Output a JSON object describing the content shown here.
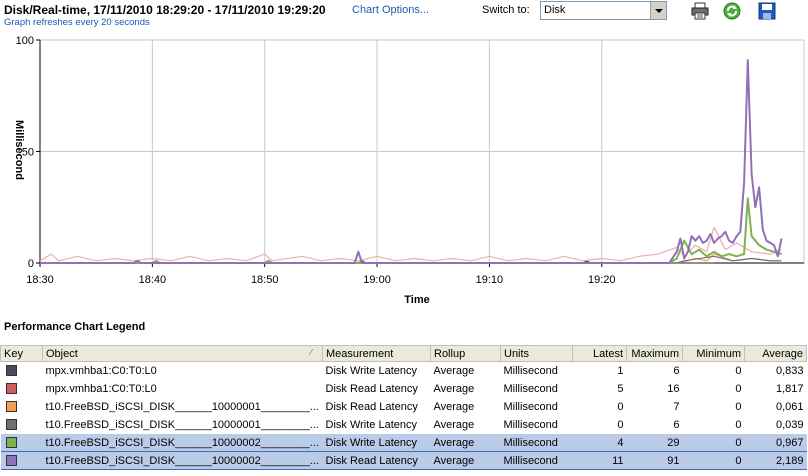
{
  "header": {
    "title": "Disk/Real-time, 17/11/2010 18:29:20 - 17/11/2010 19:29:20",
    "chart_options": "Chart Options...",
    "subtitle": "Graph refreshes every 20 seconds",
    "switch_label": "Switch to:",
    "switch_value": "Disk",
    "icons": [
      "printer-icon",
      "refresh-icon",
      "save-icon"
    ]
  },
  "chart_data": {
    "type": "line",
    "ylabel": "Millisecond",
    "xlabel": "Time",
    "ylim": [
      0,
      100
    ],
    "yticks": [
      0,
      50,
      100
    ],
    "xticks": [
      "18:30",
      "18:40",
      "18:50",
      "19:00",
      "19:10",
      "19:20"
    ],
    "grid": true,
    "series": [
      {
        "name": "mpx.vmhba1:C0:T0:L0 Disk Write Latency",
        "color": "#4a4a5a",
        "points": [
          [
            0,
            0
          ],
          [
            85,
            0
          ],
          [
            86,
            1
          ],
          [
            87,
            0
          ],
          [
            100,
            0
          ],
          [
            145,
            0
          ],
          [
            146,
            1
          ],
          [
            147,
            0
          ],
          [
            180,
            0
          ]
        ]
      },
      {
        "name": "mpx.vmhba1:C0:T0:L0 Disk Read Latency",
        "color": "#e8b0b0",
        "points": [
          [
            0,
            1
          ],
          [
            3,
            4
          ],
          [
            5,
            1
          ],
          [
            10,
            3
          ],
          [
            15,
            1
          ],
          [
            20,
            2
          ],
          [
            25,
            1
          ],
          [
            30,
            2
          ],
          [
            35,
            1
          ],
          [
            40,
            3
          ],
          [
            45,
            1
          ],
          [
            50,
            2
          ],
          [
            55,
            1
          ],
          [
            60,
            4
          ],
          [
            62,
            1
          ],
          [
            70,
            3
          ],
          [
            75,
            1
          ],
          [
            80,
            2
          ],
          [
            85,
            1
          ],
          [
            90,
            3
          ],
          [
            95,
            1
          ],
          [
            100,
            2
          ],
          [
            105,
            1
          ],
          [
            110,
            2
          ],
          [
            115,
            1
          ],
          [
            120,
            3
          ],
          [
            125,
            1
          ],
          [
            130,
            2
          ],
          [
            135,
            1
          ],
          [
            140,
            3
          ],
          [
            145,
            1
          ],
          [
            150,
            2
          ],
          [
            155,
            1
          ],
          [
            160,
            3
          ],
          [
            165,
            4
          ],
          [
            170,
            7
          ],
          [
            172,
            3
          ],
          [
            175,
            8
          ],
          [
            178,
            5
          ],
          [
            180,
            16
          ],
          [
            183,
            6
          ],
          [
            186,
            9
          ],
          [
            190,
            5
          ],
          [
            195,
            4
          ],
          [
            198,
            6
          ]
        ]
      },
      {
        "name": "t10.FreeBSD_iSCSI_DISK______10000001________... Disk Write Latency",
        "color": "#f0a050",
        "points": [
          [
            0,
            0
          ],
          [
            170,
            0
          ],
          [
            173,
            1
          ],
          [
            175,
            2
          ],
          [
            178,
            1
          ],
          [
            180,
            4
          ],
          [
            185,
            1
          ],
          [
            190,
            2
          ],
          [
            195,
            1
          ],
          [
            198,
            1
          ]
        ]
      },
      {
        "name": "t10.FreeBSD_iSCSI_DISK______10000001________... Disk Read Latency",
        "color": "#707070",
        "points": [
          [
            0,
            0
          ],
          [
            170,
            0
          ],
          [
            172,
            1
          ],
          [
            180,
            3
          ],
          [
            185,
            1
          ],
          [
            190,
            2
          ],
          [
            195,
            1
          ],
          [
            198,
            1
          ]
        ]
      },
      {
        "name": "t10.FreeBSD_iSCSI_DISK______10000002________... Disk Write Latency",
        "color": "#80b050",
        "points": [
          [
            0,
            0
          ],
          [
            30,
            0
          ],
          [
            31,
            1
          ],
          [
            32,
            0
          ],
          [
            60,
            0
          ],
          [
            61,
            1
          ],
          [
            62,
            0
          ],
          [
            168,
            0
          ],
          [
            170,
            2
          ],
          [
            172,
            10
          ],
          [
            174,
            4
          ],
          [
            176,
            6
          ],
          [
            178,
            3
          ],
          [
            180,
            5
          ],
          [
            182,
            3
          ],
          [
            184,
            4
          ],
          [
            186,
            3
          ],
          [
            188,
            4
          ],
          [
            189,
            29
          ],
          [
            190,
            12
          ],
          [
            192,
            8
          ],
          [
            194,
            6
          ],
          [
            196,
            5
          ],
          [
            198,
            4
          ]
        ]
      },
      {
        "name": "t10.FreeBSD_iSCSI_DISK______10000002________... Disk Read Latency",
        "color": "#9070b8",
        "points": [
          [
            0,
            0
          ],
          [
            25,
            0
          ],
          [
            26,
            1
          ],
          [
            27,
            0
          ],
          [
            84,
            0
          ],
          [
            85,
            5
          ],
          [
            86,
            0
          ],
          [
            168,
            0
          ],
          [
            170,
            5
          ],
          [
            171,
            11
          ],
          [
            172,
            2
          ],
          [
            173,
            5
          ],
          [
            174,
            12
          ],
          [
            175,
            10
          ],
          [
            176,
            12
          ],
          [
            177,
            9
          ],
          [
            178,
            10
          ],
          [
            179,
            13
          ],
          [
            180,
            9
          ],
          [
            181,
            11
          ],
          [
            182,
            12
          ],
          [
            183,
            14
          ],
          [
            184,
            10
          ],
          [
            185,
            9
          ],
          [
            186,
            12
          ],
          [
            187,
            14
          ],
          [
            188,
            36
          ],
          [
            189,
            91
          ],
          [
            190,
            40
          ],
          [
            191,
            25
          ],
          [
            192,
            34
          ],
          [
            193,
            15
          ],
          [
            194,
            10
          ],
          [
            195,
            9
          ],
          [
            196,
            8
          ],
          [
            197,
            3
          ],
          [
            198,
            11
          ]
        ]
      }
    ]
  },
  "legend": {
    "title": "Performance Chart Legend",
    "columns": [
      "Key",
      "Object",
      "Measurement",
      "Rollup",
      "Units",
      "Latest",
      "Maximum",
      "Minimum",
      "Average"
    ],
    "rows": [
      {
        "color": "#4a4a5a",
        "object": "mpx.vmhba1:C0:T0:L0",
        "measurement": "Disk Write Latency",
        "rollup": "Average",
        "units": "Millisecond",
        "latest": "1",
        "maximum": "6",
        "minimum": "0",
        "average": "0,833",
        "selected": false
      },
      {
        "color": "#d06060",
        "object": "mpx.vmhba1:C0:T0:L0",
        "measurement": "Disk Read Latency",
        "rollup": "Average",
        "units": "Millisecond",
        "latest": "5",
        "maximum": "16",
        "minimum": "0",
        "average": "1,817",
        "selected": false
      },
      {
        "color": "#f0a050",
        "object": "t10.FreeBSD_iSCSI_DISK______10000001________...",
        "measurement": "Disk Read Latency",
        "rollup": "Average",
        "units": "Millisecond",
        "latest": "0",
        "maximum": "7",
        "minimum": "0",
        "average": "0,061",
        "selected": false
      },
      {
        "color": "#707070",
        "object": "t10.FreeBSD_iSCSI_DISK______10000001________...",
        "measurement": "Disk Write Latency",
        "rollup": "Average",
        "units": "Millisecond",
        "latest": "0",
        "maximum": "6",
        "minimum": "0",
        "average": "0,039",
        "selected": false
      },
      {
        "color": "#80b050",
        "object": "t10.FreeBSD_iSCSI_DISK______10000002________...",
        "measurement": "Disk Write Latency",
        "rollup": "Average",
        "units": "Millisecond",
        "latest": "4",
        "maximum": "29",
        "minimum": "0",
        "average": "0,967",
        "selected": true
      },
      {
        "color": "#9070b8",
        "object": "t10.FreeBSD_iSCSI_DISK______10000002________...",
        "measurement": "Disk Read Latency",
        "rollup": "Average",
        "units": "Millisecond",
        "latest": "11",
        "maximum": "91",
        "minimum": "0",
        "average": "2,189",
        "selected": true
      }
    ]
  }
}
